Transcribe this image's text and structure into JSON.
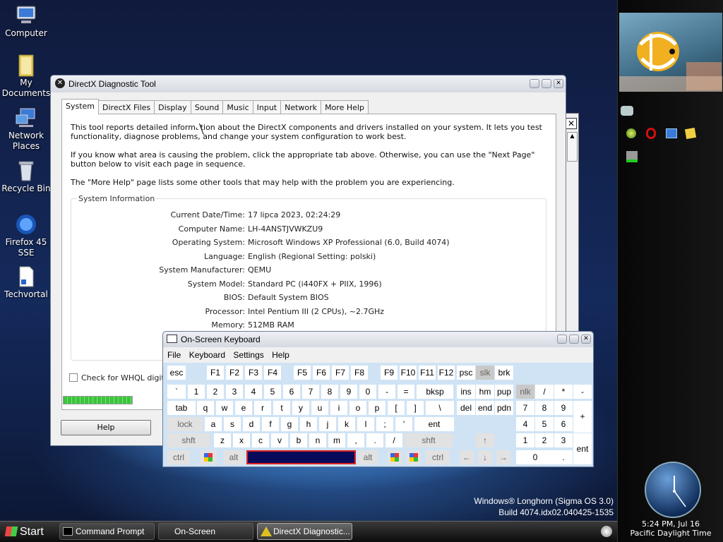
{
  "desktop": {
    "icons": [
      {
        "label": "Computer"
      },
      {
        "label": "My Documents"
      },
      {
        "label": "Network Places"
      },
      {
        "label": "Recycle Bin"
      },
      {
        "label": "Firefox 45 SSE"
      },
      {
        "label": "Techvortal"
      }
    ],
    "watermark": {
      "line1": "Windows® Longhorn (Sigma OS 3.0)",
      "line2": "Build 4074.idx02.040425-1535"
    }
  },
  "dxdiag": {
    "title": "DirectX Diagnostic Tool",
    "tabs": [
      "System",
      "DirectX Files",
      "Display",
      "Sound",
      "Music",
      "Input",
      "Network",
      "More Help"
    ],
    "intro1": "This tool reports detailed information about the DirectX components and drivers installed on your system.  It lets you test functionality, diagnose problems, and change your system configuration to work best.",
    "intro2": "If you know what area is causing the problem, click the appropriate tab above.  Otherwise, you can use the \"Next Page\" button below to visit each page in sequence.",
    "intro3": "The \"More Help\" page lists some other tools that may help with the problem you are experiencing.",
    "group_title": "System Information",
    "rows": [
      {
        "label": "Current Date/Time:",
        "value": "17 lipca 2023, 02:24:29"
      },
      {
        "label": "Computer Name:",
        "value": "LH-4ANSTJVWKZU9"
      },
      {
        "label": "Operating System:",
        "value": "Microsoft Windows XP Professional (6.0, Build 4074)"
      },
      {
        "label": "Language:",
        "value": "English (Regional Setting: polski)"
      },
      {
        "label": "System Manufacturer:",
        "value": "QEMU"
      },
      {
        "label": "System Model:",
        "value": "Standard PC (i440FX + PIIX, 1996)"
      },
      {
        "label": "BIOS:",
        "value": "Default System BIOS"
      },
      {
        "label": "Processor:",
        "value": "Intel Pentium III (2 CPUs), ~2.7GHz"
      },
      {
        "label": "Memory:",
        "value": "512MB RAM"
      }
    ],
    "whql_label": "Check for WHQL digita",
    "help_button": "Help"
  },
  "osk": {
    "title": "On-Screen Keyboard",
    "menu": [
      "File",
      "Keyboard",
      "Settings",
      "Help"
    ],
    "rows": {
      "r1": [
        "esc",
        "F1",
        "F2",
        "F3",
        "F4",
        "F5",
        "F6",
        "F7",
        "F8",
        "F9",
        "F10",
        "F11",
        "F12",
        "psc",
        "slk",
        "brk"
      ],
      "r2": [
        "`",
        "1",
        "2",
        "3",
        "4",
        "5",
        "6",
        "7",
        "8",
        "9",
        "0",
        "-",
        "=",
        "bksp",
        "ins",
        "hm",
        "pup",
        "nlk",
        "/",
        "*",
        "-"
      ],
      "r3": [
        "tab",
        "q",
        "w",
        "e",
        "r",
        "t",
        "y",
        "u",
        "i",
        "o",
        "p",
        "[",
        "]",
        "\\",
        "del",
        "end",
        "pdn",
        "7",
        "8",
        "9",
        "+"
      ],
      "r4": [
        "lock",
        "a",
        "s",
        "d",
        "f",
        "g",
        "h",
        "j",
        "k",
        "l",
        ";",
        "'",
        "ent",
        "4",
        "5",
        "6"
      ],
      "r5": [
        "shft",
        "z",
        "x",
        "c",
        "v",
        "b",
        "n",
        "m",
        ",",
        ".",
        "/",
        "shft",
        "↑",
        "1",
        "2",
        "3",
        "ent"
      ],
      "r6": [
        "ctrl",
        "alt",
        "alt",
        "ctrl",
        "←",
        "↓",
        "→",
        "0",
        "."
      ]
    }
  },
  "taskbar": {
    "start": "Start",
    "tasks": [
      "Command Prompt",
      "On-Screen Keyboa...",
      "DirectX Diagnostic..."
    ]
  },
  "sidebar": {
    "clock_time": "5:24 PM, Jul 16",
    "clock_zone": "Pacific Daylight Time"
  },
  "colors": {
    "selection": "#0a0a5a",
    "progress": "#3cc43c",
    "accent": "#2a4f8f"
  }
}
